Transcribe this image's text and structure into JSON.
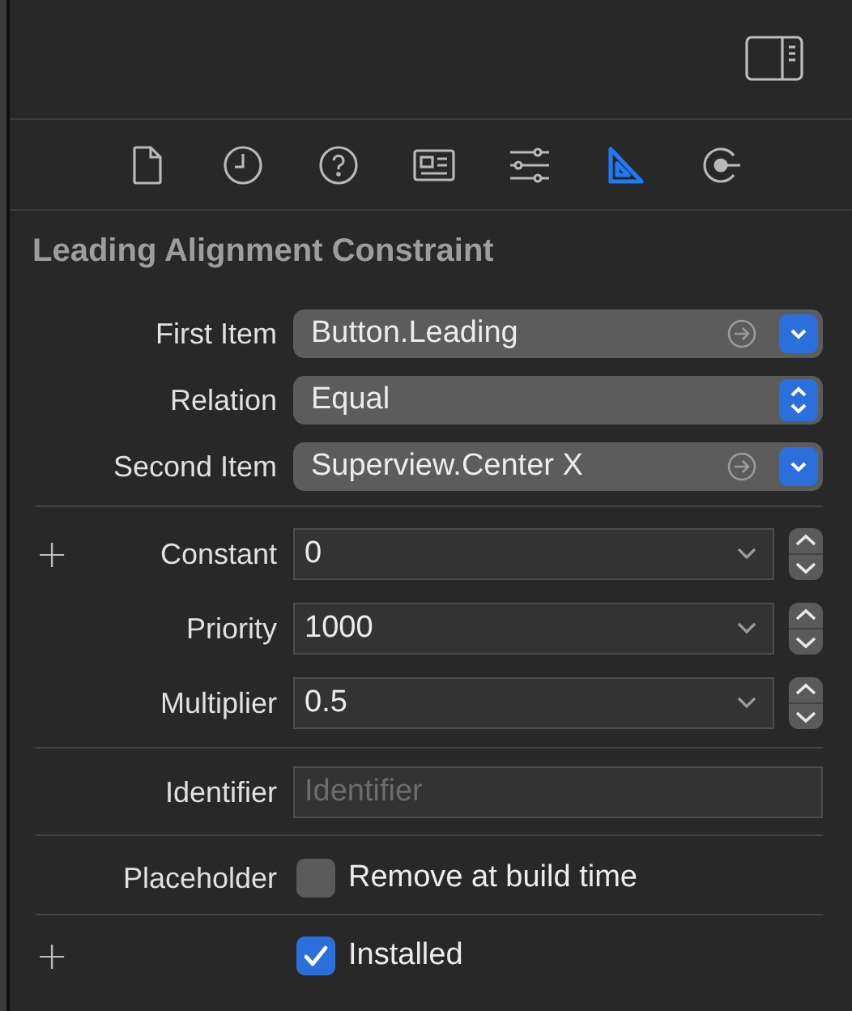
{
  "tabs": [
    {
      "kind": "file",
      "selected": false
    },
    {
      "kind": "history",
      "selected": false
    },
    {
      "kind": "help",
      "selected": false
    },
    {
      "kind": "identity",
      "selected": false
    },
    {
      "kind": "attributes",
      "selected": false
    },
    {
      "kind": "size",
      "selected": true
    },
    {
      "kind": "connections",
      "selected": false
    }
  ],
  "title": "Leading Alignment Constraint",
  "sections": [
    {
      "rows": [
        {
          "kind": "popup",
          "label": "First Item",
          "value": "Button.Leading"
        },
        {
          "kind": "select",
          "label": "Relation",
          "value": "Equal"
        },
        {
          "kind": "popup",
          "label": "Second Item",
          "value": "Superview.Center X"
        }
      ]
    },
    {
      "rows": [
        {
          "kind": "combo",
          "label": "Constant",
          "value": "0",
          "add_button": "+"
        },
        {
          "kind": "combo",
          "label": "Priority",
          "value": "1000"
        },
        {
          "kind": "combo",
          "label": "Multiplier",
          "value": "0.5"
        }
      ]
    },
    {
      "rows": [
        {
          "kind": "text",
          "label": "Identifier",
          "placeholder": "Identifier"
        }
      ]
    },
    {
      "rows": [
        {
          "kind": "checkbox",
          "label": "Placeholder",
          "text": "Remove at build time",
          "checked": false
        }
      ]
    },
    {
      "rows": [
        {
          "kind": "checkbox",
          "text": "Installed",
          "checked": true,
          "add_button": "+"
        }
      ]
    }
  ]
}
